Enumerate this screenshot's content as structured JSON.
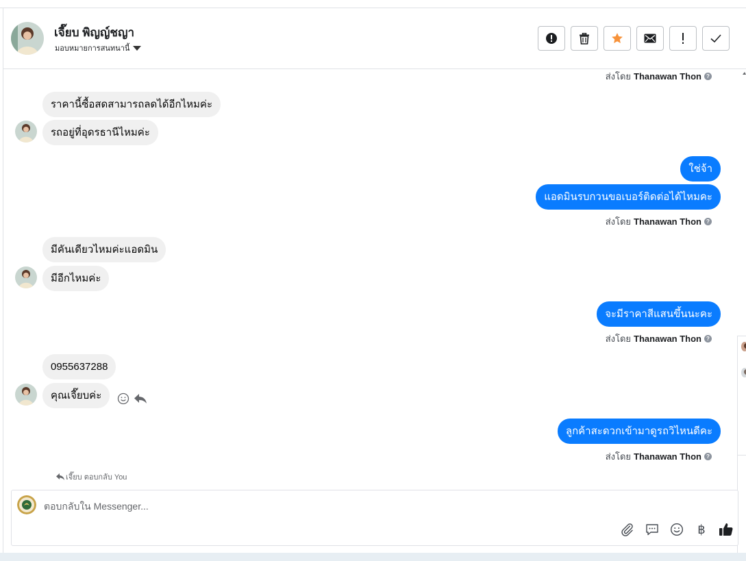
{
  "contact": {
    "name": "เจี๊ยบ พิญญ์ชญา",
    "assign_label": "มอบหมายการสนทนานี้"
  },
  "sent_by": {
    "prefix": "ส่งโดย",
    "agent": "Thanawan Thon",
    "help": "?"
  },
  "messages": [
    {
      "side": "in",
      "text": "ราคานี้ซื้อสดสามารถลดได้อีกไหมค่ะ"
    },
    {
      "side": "in",
      "text": "รถอยู่ที่อุดรธานีไหมค่ะ"
    },
    {
      "side": "out",
      "text": "ใช่จ้า"
    },
    {
      "side": "out",
      "text": "แอดมินรบกวนขอเบอร์ติดต่อได้ไหมคะ"
    },
    {
      "side": "in",
      "text": "มีคันเดียวไหมค่ะแอดมิน"
    },
    {
      "side": "in",
      "text": "มีอีกไหมค่ะ"
    },
    {
      "side": "out",
      "text": "จะมีราคาสีแสนขึ้นนะคะ"
    },
    {
      "side": "in",
      "text": "0955637288"
    },
    {
      "side": "in",
      "text": "คุณเจี๊ยบค่ะ"
    },
    {
      "side": "out",
      "text": "ลูกค้าสะดวกเข้ามาดูรถวิไหนดีคะ"
    }
  ],
  "reply_note": "เจี๊ยบ ตอบกลับ You",
  "composer": {
    "placeholder": "ตอบกลับใน Messenger..."
  },
  "icons": {
    "header_actions": [
      "alert-circle-icon",
      "trash-icon",
      "star-icon",
      "envelope-icon",
      "exclamation-icon",
      "checkmark-icon"
    ],
    "composer_tools": [
      "paperclip-icon",
      "saved-reply-icon",
      "emoji-icon",
      "baht-icon",
      "thumbs-up-icon"
    ]
  },
  "colors": {
    "outgoing_bubble": "#0a7cff",
    "incoming_bubble": "#f0f0f0",
    "star": "#f7923a"
  }
}
